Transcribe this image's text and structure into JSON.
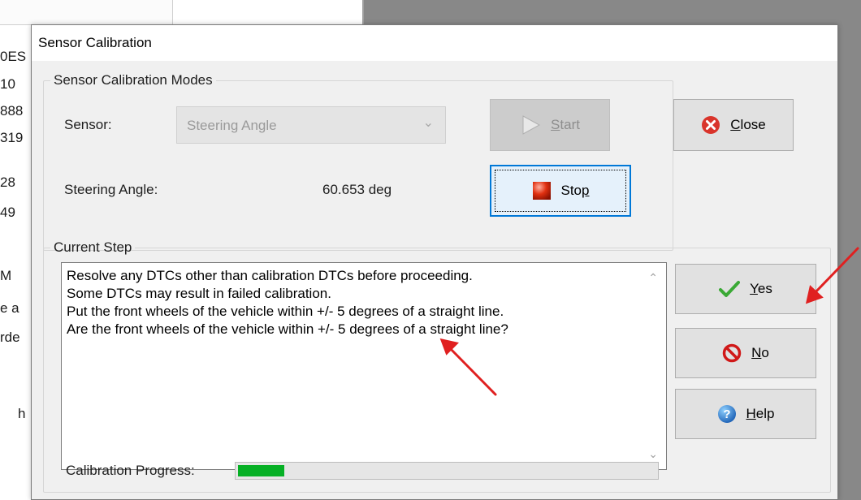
{
  "background": {
    "fragments": [
      "0ES",
      "10",
      "888",
      "319",
      "28",
      "49",
      "M",
      "e a",
      "rde",
      "h"
    ]
  },
  "dialog": {
    "title": "Sensor Calibration",
    "modes_group": {
      "legend": "Sensor Calibration Modes",
      "sensor_label": "Sensor:",
      "sensor_value": "Steering Angle",
      "reading_label": "Steering Angle:",
      "reading_value": "60.653 deg"
    },
    "buttons": {
      "start": {
        "label_pre": "",
        "label_key": "S",
        "label_post": "tart",
        "enabled": false
      },
      "stop": {
        "label_pre": "Sto",
        "label_key": "p",
        "label_post": ""
      },
      "close": {
        "label_pre": "",
        "label_key": "C",
        "label_post": "lose"
      },
      "yes": {
        "label_pre": "",
        "label_key": "Y",
        "label_post": "es"
      },
      "no": {
        "label_pre": "",
        "label_key": "N",
        "label_post": "o"
      },
      "help": {
        "label_pre": "",
        "label_key": "H",
        "label_post": "elp"
      }
    },
    "step_group": {
      "legend": "Current Step",
      "lines": [
        "Resolve any DTCs other than calibration DTCs before proceeding.",
        "Some DTCs may result in failed calibration.",
        "Put the front wheels of the vehicle within +/- 5 degrees of a straight line.",
        "Are the front wheels of the vehicle within +/- 5 degrees of a straight line?"
      ]
    },
    "progress": {
      "label": "Calibration Progress:",
      "value_fraction": 0.11
    }
  },
  "colors": {
    "progress_fill": "#06b025",
    "focus_border": "#0078d7",
    "annotation_arrow": "#e02020"
  },
  "icons": [
    "play-icon",
    "stop-icon",
    "close-x-icon",
    "checkmark-icon",
    "no-sign-icon",
    "help-icon",
    "chevron-down-icon"
  ]
}
